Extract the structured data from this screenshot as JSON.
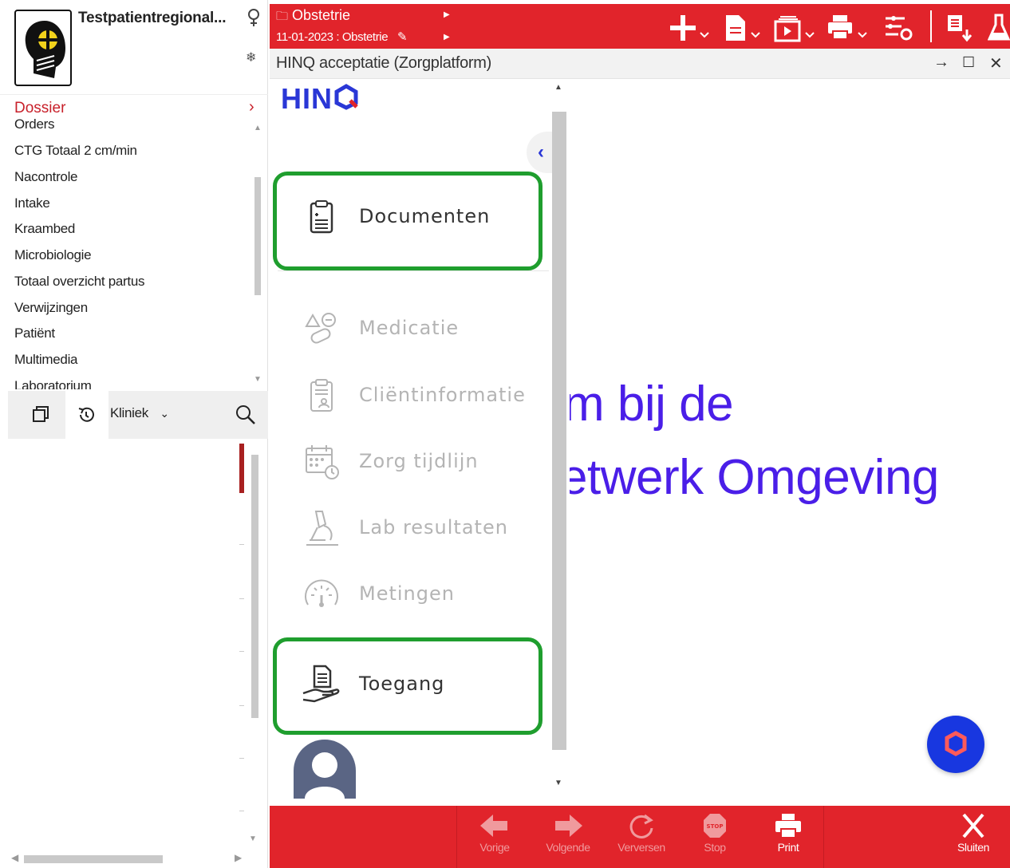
{
  "patient": {
    "name": "Testpatientregional...",
    "icons": [
      "female-gender-icon",
      "snowflake-icon",
      "patient-photo-placeholder"
    ]
  },
  "dossier": {
    "label": "Dossier",
    "items": [
      "Orders",
      "CTG Totaal 2 cm/min",
      "Nacontrole",
      "Intake",
      "Kraambed",
      "Microbiologie",
      "Totaal overzicht partus",
      "Verwijzingen",
      "Patiënt",
      "Multimedia",
      "Laboratorium"
    ]
  },
  "left_toolbar": {
    "location_select": "Kliniek",
    "icons": [
      "windows-icon",
      "history-icon",
      "search-icon"
    ]
  },
  "topbar": {
    "breadcrumb_module": "Obstetrie",
    "breadcrumb_episode": "11-01-2023 : Obstetrie",
    "icons": [
      "add-icon",
      "document-icon",
      "video-document-icon",
      "printer-icon",
      "settings-sliders-icon",
      "list-arrow-icon",
      "lab-flask-icon"
    ]
  },
  "portal": {
    "title": "HINQ acceptatie (Zorgplatform)"
  },
  "hinq": {
    "logo_text": "HIN",
    "menu": [
      {
        "label": "Documenten",
        "icon": "clipboard-document-icon",
        "state": "active"
      },
      {
        "label": "Medicatie",
        "icon": "medication-pills-icon",
        "state": "disabled"
      },
      {
        "label": "Cliëntinformatie",
        "icon": "client-info-clipboard-icon",
        "state": "disabled"
      },
      {
        "label": "Zorg tijdlijn",
        "icon": "calendar-clock-icon",
        "state": "disabled"
      },
      {
        "label": "Lab resultaten",
        "icon": "microscope-icon",
        "state": "disabled"
      },
      {
        "label": "Metingen",
        "icon": "gauge-icon",
        "state": "disabled"
      },
      {
        "label": "Toegang",
        "icon": "document-hand-icon",
        "state": "active"
      }
    ],
    "highlighted": [
      "Documenten",
      "Toegang"
    ]
  },
  "content": {
    "welcome_line1": "m bij de",
    "welcome_line2": "etwerk Omgeving"
  },
  "bottom_bar": {
    "buttons": [
      {
        "label": "Vorige",
        "icon": "arrow-left-icon",
        "enabled": false
      },
      {
        "label": "Volgende",
        "icon": "arrow-right-icon",
        "enabled": false
      },
      {
        "label": "Verversen",
        "icon": "refresh-icon",
        "enabled": false
      },
      {
        "label": "Stop",
        "icon": "stop-sign-icon",
        "enabled": false
      },
      {
        "label": "Print",
        "icon": "printer-icon",
        "enabled": true
      },
      {
        "label": "Sluiten",
        "icon": "close-icon",
        "enabled": true
      }
    ]
  },
  "colors": {
    "accent_red": "#e1242b",
    "hinq_blue": "#2a37d6",
    "welcome_purple": "#4a1ee8",
    "highlight_green": "#1f9e2e",
    "dossier_red": "#c8202a"
  }
}
